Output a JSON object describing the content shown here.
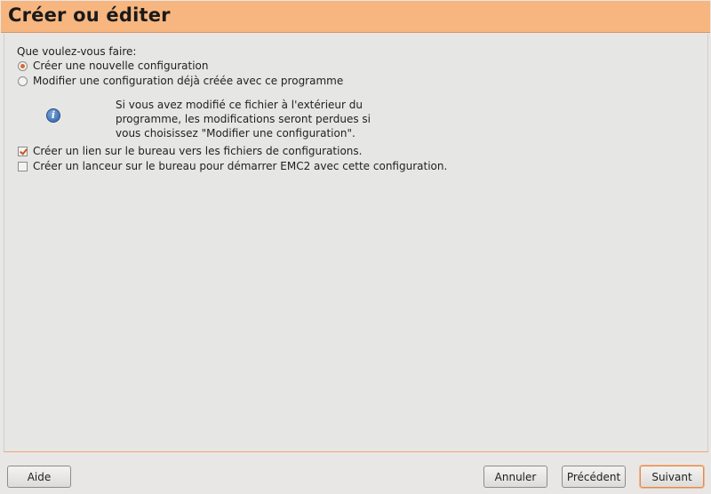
{
  "header": {
    "title": "Créer ou éditer"
  },
  "main": {
    "prompt": "Que voulez-vous faire:",
    "options": [
      {
        "label": "Créer une nouvelle configuration",
        "selected": true
      },
      {
        "label": "Modifier une configuration déjà créée avec ce programme",
        "selected": false
      }
    ],
    "info_icon": "info-icon",
    "info_lines": [
      "Si vous avez modifié ce fichier à l'extérieur du",
      "programme, les modifications seront perdues si",
      "vous choisissez \"Modifier une configuration\"."
    ],
    "checkboxes": [
      {
        "label": "Créer un lien sur le bureau vers les fichiers de configurations.",
        "checked": true
      },
      {
        "label": "Créer un lanceur sur le bureau pour démarrer EMC2 avec cette configuration.",
        "checked": false
      }
    ]
  },
  "footer": {
    "help_label": "Aide",
    "cancel_label": "Annuler",
    "previous_label": "Précédent",
    "next_label": "Suivant"
  },
  "colors": {
    "header_bg": "#f7b67f",
    "accent": "#d66a2e"
  }
}
